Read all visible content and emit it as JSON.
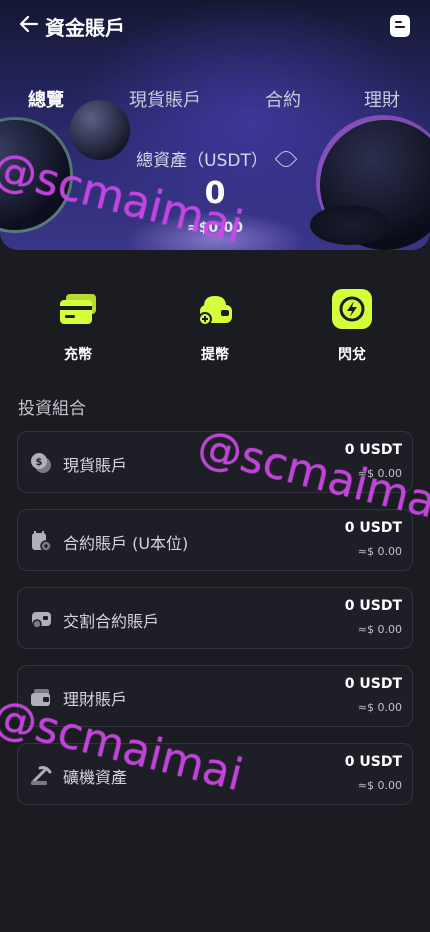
{
  "header": {
    "title": "資金賬戶",
    "back_icon": "arrow-left-icon",
    "doc_icon": "document-icon"
  },
  "tabs": [
    {
      "label": "總覽",
      "active": true
    },
    {
      "label": "現貨賬戶",
      "active": false
    },
    {
      "label": "合約",
      "active": false
    },
    {
      "label": "理財",
      "active": false
    }
  ],
  "overview": {
    "label": "總資產（USDT）",
    "value": "0",
    "approx": "≈$0.00"
  },
  "actions": [
    {
      "label": "充幣",
      "icon": "wallet-card-icon"
    },
    {
      "label": "提幣",
      "icon": "withdraw-icon"
    },
    {
      "label": "閃兌",
      "icon": "lightning-icon"
    }
  ],
  "portfolio": {
    "title": "投資組合",
    "items": [
      {
        "name": "現貨賬戶",
        "value": "0 USDT",
        "approx": "≈$ 0.00",
        "icon": "coins-icon"
      },
      {
        "name": "合約賬戶 (U本位)",
        "value": "0 USDT",
        "approx": "≈$ 0.00",
        "icon": "contract-icon"
      },
      {
        "name": "交割合約賬戶",
        "value": "0 USDT",
        "approx": "≈$ 0.00",
        "icon": "delivery-icon"
      },
      {
        "name": "理財賬戶",
        "value": "0 USDT",
        "approx": "≈$ 0.00",
        "icon": "finance-wallet-icon"
      },
      {
        "name": "礦機資產",
        "value": "0 USDT",
        "approx": "≈$ 0.00",
        "icon": "mining-icon"
      }
    ]
  },
  "watermark": "@scmaimai",
  "colors": {
    "accent": "#d4ff3a",
    "background": "#1b1c22",
    "watermark": "#c83ce6"
  }
}
